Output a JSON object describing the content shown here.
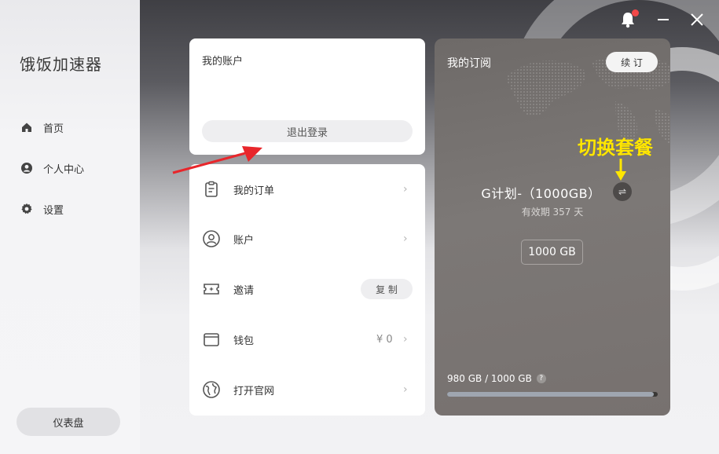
{
  "app": {
    "title": "饿饭加速器"
  },
  "sidebar": {
    "items": [
      {
        "label": "首页",
        "icon": "home-icon"
      },
      {
        "label": "个人中心",
        "icon": "user-icon"
      },
      {
        "label": "设置",
        "icon": "gear-icon"
      }
    ],
    "dashboard_label": "仪表盘"
  },
  "account": {
    "title": "我的账户",
    "logout_label": "退出登录"
  },
  "menu": {
    "orders_label": "我的订单",
    "account_label": "账户",
    "invite_label": "邀请",
    "copy_label": "复 制",
    "wallet_label": "钱包",
    "wallet_value": "¥ 0",
    "website_label": "打开官网"
  },
  "subscription": {
    "title": "我的订阅",
    "renew_label": "续 订",
    "plan_name": "G计划-（1000GB）",
    "switch_glyph": "⇌",
    "validity": "有效期 357 天",
    "quota": "1000 GB",
    "usage": "980 GB / 1000 GB",
    "help_glyph": "?",
    "used_fraction": 0.98
  },
  "annotation": {
    "switch_plan": "切换套餐"
  },
  "colors": {
    "accent_yellow": "#ffe600",
    "arrow_red": "#e8262b",
    "notification_dot": "#f24848"
  }
}
